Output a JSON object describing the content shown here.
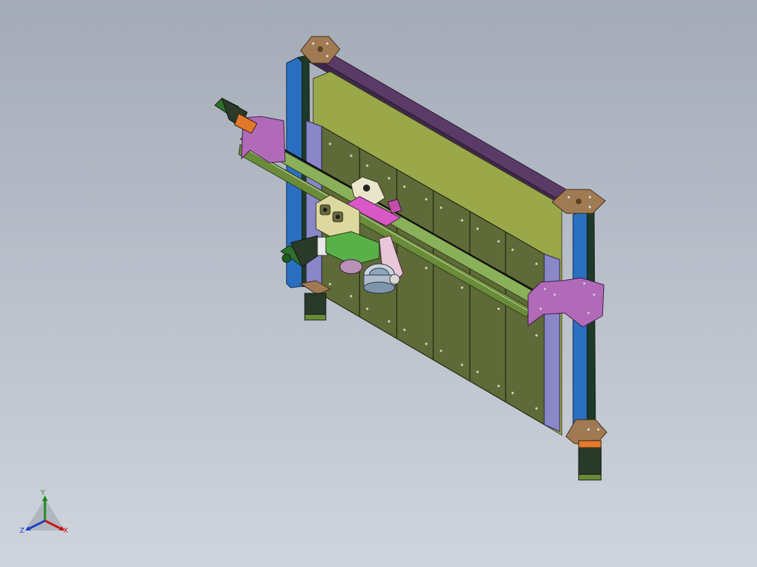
{
  "viewport": {
    "background_top": "#a3abb7",
    "background_bottom": "#cfd4dc"
  },
  "model": {
    "parts": [
      "cnc-gantry-frame",
      "stepper-motor",
      "linear-rail",
      "spindle",
      "mounting-plate"
    ],
    "colors": {
      "back_panel": "#9aa84a",
      "panels": "#5e6a38",
      "frame_blue": "#2a6fc0",
      "frame_violet": "#8a86c8",
      "bracket_pink": "#b06ab8",
      "corner_plate": "#a07a52",
      "motor": "#2a3a2a",
      "rail": "#7a9a48"
    }
  },
  "triad": {
    "x_label": "X",
    "y_label": "Y",
    "z_label": "Z",
    "x_color": "#c81010",
    "y_color": "#1a8a1a",
    "z_color": "#1a3fc8"
  }
}
